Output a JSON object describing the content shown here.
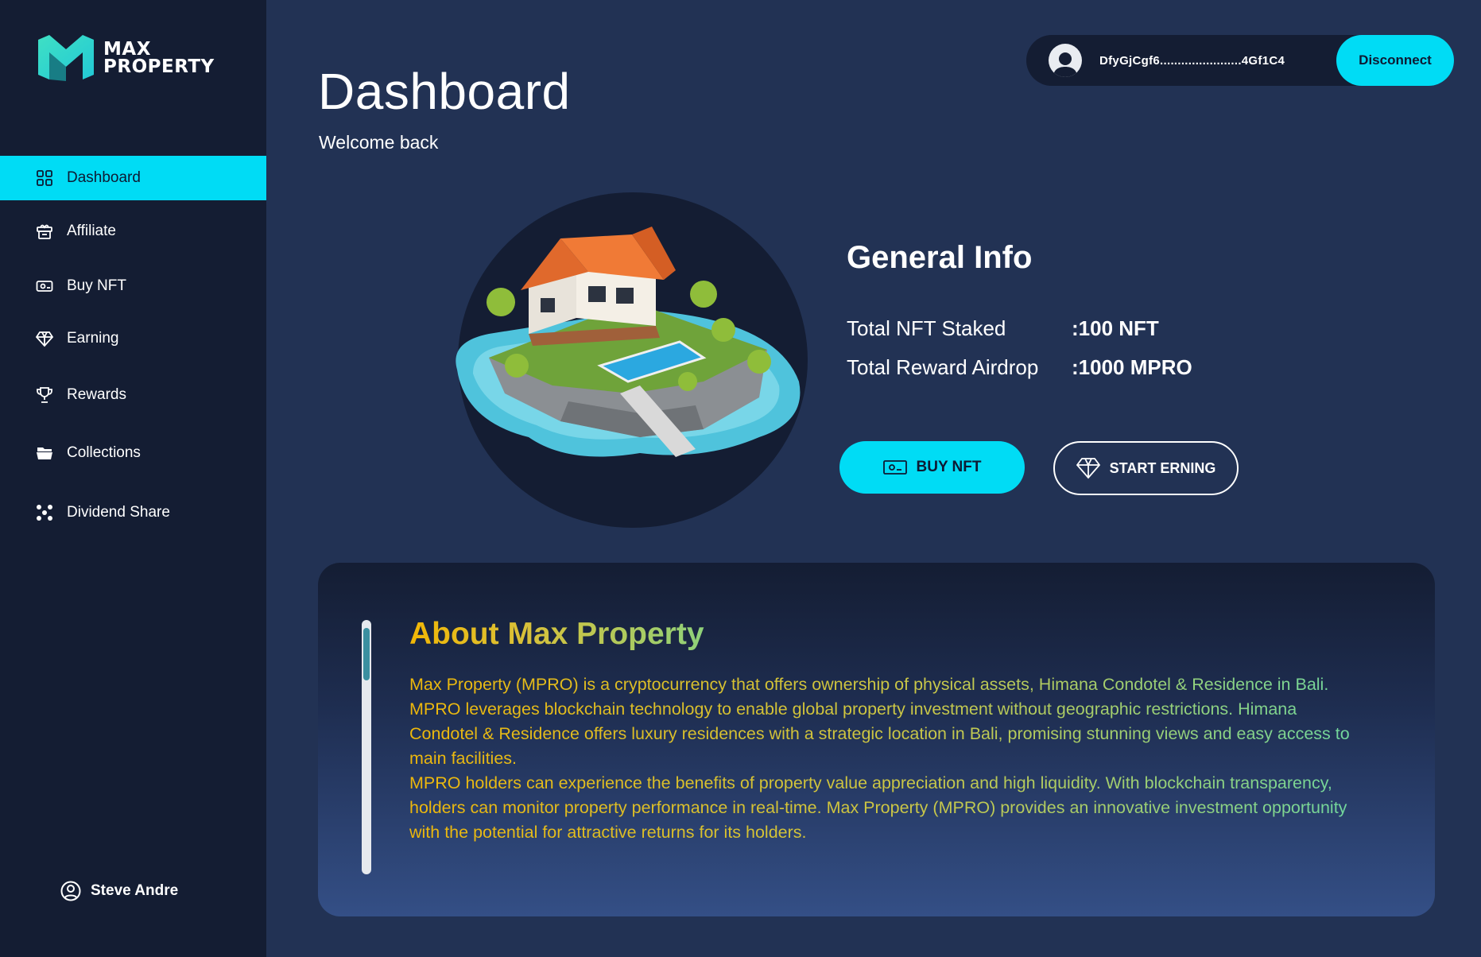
{
  "brand": {
    "line1": "MAX",
    "line2": "PROPERTY"
  },
  "sidebar": {
    "items": [
      {
        "label": "Dashboard",
        "icon": "grid-icon",
        "active": true
      },
      {
        "label": "Affiliate",
        "icon": "gift-box-icon",
        "active": false
      },
      {
        "label": "Buy NFT",
        "icon": "banknote-icon",
        "active": false
      },
      {
        "label": "Earning",
        "icon": "diamond-icon",
        "active": false
      },
      {
        "label": "Rewards",
        "icon": "trophy-icon",
        "active": false
      },
      {
        "label": "Collections",
        "icon": "folder-icon",
        "active": false
      },
      {
        "label": "Dividend Share",
        "icon": "dots-network-icon",
        "active": false
      }
    ],
    "user": {
      "name": "Steve Andre",
      "icon": "user-circle-icon"
    }
  },
  "header": {
    "title": "Dashboard",
    "subtitle": "Welcome back",
    "wallet": {
      "address": "DfyGjCgf6.......................4Gf1C4",
      "disconnect_label": "Disconnect"
    }
  },
  "general_info": {
    "title": "General Info",
    "rows": [
      {
        "label": "Total NFT Staked",
        "value": ":100 NFT"
      },
      {
        "label": "Total Reward Airdrop",
        "value": ":1000 MPRO"
      }
    ],
    "buy_label": "BUY NFT",
    "earn_label": "START ERNING"
  },
  "about": {
    "title": "About Max Property",
    "paragraphs": [
      "Max Property (MPRO) is a cryptocurrency that offers ownership of physical assets, Himana Condotel & Residence in Bali. MPRO leverages blockchain technology to enable global property investment without geographic restrictions. Himana Condotel & Residence offers luxury residences with a strategic location in Bali, promising stunning views and easy access to main facilities.",
      "MPRO holders can experience the benefits of property value appreciation and high liquidity. With blockchain transparency, holders can monitor property performance in real-time. Max Property (MPRO) provides an innovative investment opportunity with the potential for attractive returns for its holders."
    ]
  },
  "colors": {
    "accent": "#00dcf5",
    "sidebar": "#141d33",
    "background": "#223254"
  }
}
